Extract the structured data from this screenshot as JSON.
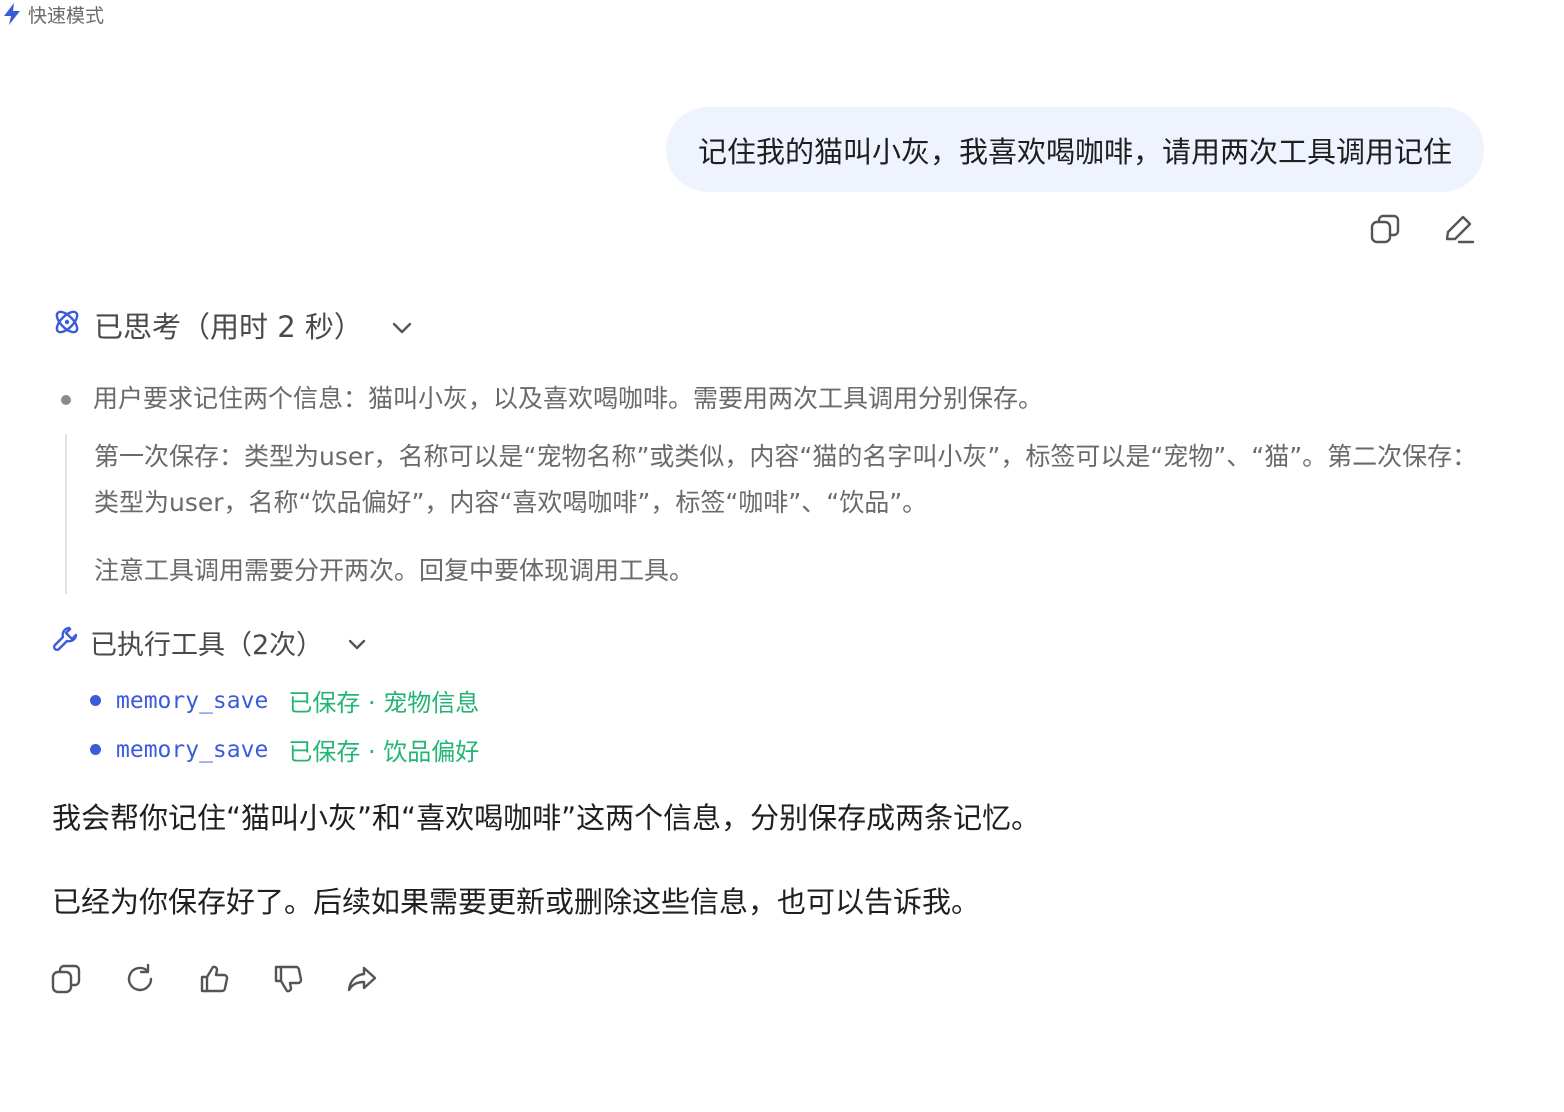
{
  "mode": {
    "icon": "lightning-icon",
    "label": "快速模式",
    "accent": "#3b5bdb"
  },
  "user_message": {
    "text": "记住我的猫叫小灰，我喜欢喝咖啡，请用两次工具调用记住",
    "bubble_color": "#eef3fe",
    "actions": [
      "copy-icon",
      "edit-icon"
    ]
  },
  "thinking": {
    "icon": "atom-icon",
    "header": "已思考（用时 2 秒）",
    "bullet": "用户要求记住两个信息：猫叫小灰，以及喜欢喝咖啡。需要用两次工具调用分别保存。",
    "paragraphs": [
      "第一次保存：类型为user，名称可以是“宠物名称”或类似，内容“猫的名字叫小灰”，标签可以是“宠物”、“猫”。第二次保存：类型为user，名称“饮品偏好”，内容“喜欢喝咖啡”，标签“咖啡”、“饮品”。",
      "注意工具调用需要分开两次。回复中要体现调用工具。"
    ]
  },
  "tools": {
    "icon": "wrench-icon",
    "header": "已执行工具（2次）",
    "items": [
      {
        "name": "memory_save",
        "status": "已保存 · 宠物信息"
      },
      {
        "name": "memory_save",
        "status": "已保存 · 饮品偏好"
      }
    ],
    "name_color": "#3b5bdb",
    "status_color": "#22b573"
  },
  "answer": {
    "paragraphs": [
      "我会帮你记住“猫叫小灰”和“喜欢喝咖啡”这两个信息，分别保存成两条记忆。",
      "已经为你保存好了。后续如果需要更新或删除这些信息，也可以告诉我。"
    ],
    "actions": [
      "copy-icon",
      "regenerate-icon",
      "thumbs-up-icon",
      "thumbs-down-icon",
      "share-icon"
    ]
  }
}
